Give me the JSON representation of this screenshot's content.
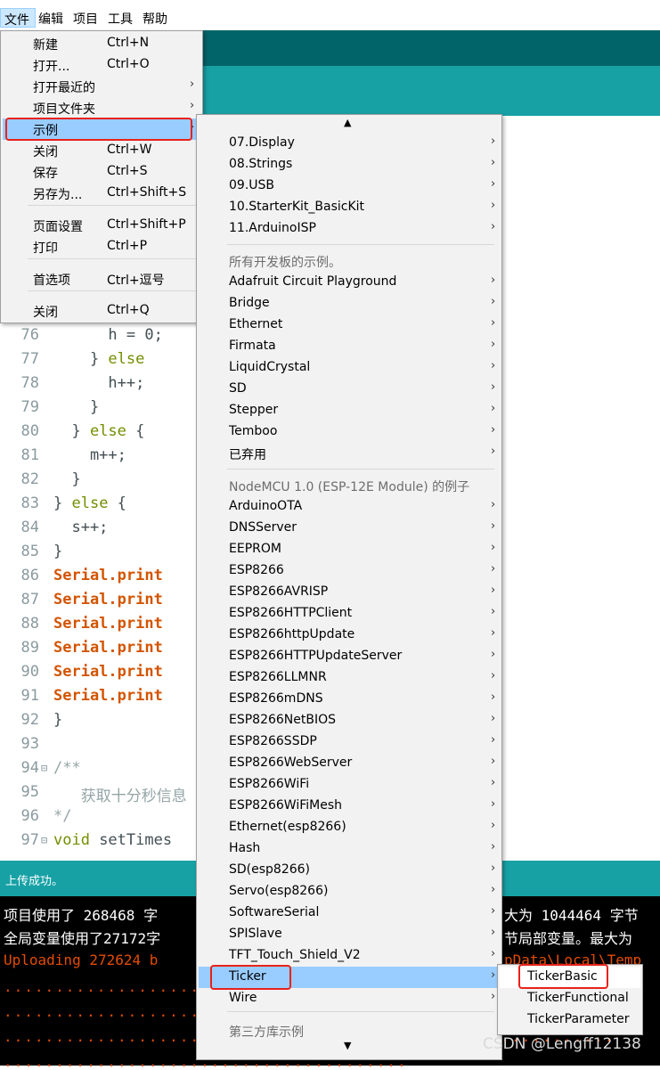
{
  "menubar": {
    "items": [
      "文件",
      "编辑",
      "项目",
      "工具",
      "帮助"
    ]
  },
  "file_menu": {
    "items": [
      {
        "label": "新建",
        "shortcut": "Ctrl+N"
      },
      {
        "label": "打开...",
        "shortcut": "Ctrl+O"
      },
      {
        "label": "打开最近的",
        "shortcut": "",
        "submenu": true
      },
      {
        "label": "项目文件夹",
        "shortcut": "",
        "submenu": true
      },
      {
        "label": "示例",
        "shortcut": "",
        "submenu": true,
        "selected": true
      },
      {
        "label": "关闭",
        "shortcut": "Ctrl+W"
      },
      {
        "label": "保存",
        "shortcut": "Ctrl+S"
      },
      {
        "label": "另存为...",
        "shortcut": "Ctrl+Shift+S"
      },
      {
        "label": "页面设置",
        "shortcut": "Ctrl+Shift+P"
      },
      {
        "label": "打印",
        "shortcut": "Ctrl+P"
      },
      {
        "label": "首选项",
        "shortcut": "Ctrl+逗号"
      },
      {
        "label": "关闭",
        "shortcut": "Ctrl+Q"
      }
    ]
  },
  "examples_menu": {
    "scroll_up": "▲",
    "scroll_down": "▼",
    "builtin": [
      "07.Display",
      "08.Strings",
      "09.USB",
      "10.StarterKit_BasicKit",
      "11.ArduinoISP"
    ],
    "all_boards_header": "所有开发板的示例。",
    "all_boards": [
      "Adafruit Circuit Playground",
      "Bridge",
      "Ethernet",
      "Firmata",
      "LiquidCrystal",
      "SD",
      "Stepper",
      "Temboo",
      "已弃用"
    ],
    "board_header": "NodeMCU 1.0 (ESP-12E Module) 的例子",
    "board": [
      "ArduinoOTA",
      "DNSServer",
      "EEPROM",
      "ESP8266",
      "ESP8266AVRISP",
      "ESP8266HTTPClient",
      "ESP8266httpUpdate",
      "ESP8266HTTPUpdateServer",
      "ESP8266LLMNR",
      "ESP8266mDNS",
      "ESP8266NetBIOS",
      "ESP8266SSDP",
      "ESP8266WebServer",
      "ESP8266WiFi",
      "ESP8266WiFiMesh",
      "Ethernet(esp8266)",
      "Hash",
      "SD(esp8266)",
      "Servo(esp8266)",
      "SoftwareSerial",
      "SPISlave",
      "TFT_Touch_Shield_V2",
      "Ticker",
      "Wire"
    ],
    "selected": "Ticker",
    "third_party_header": "第三方库示例"
  },
  "ticker_menu": {
    "items": [
      "TickerBasic",
      "TickerFunctional",
      "TickerParameter"
    ],
    "highlighted": "TickerBasic"
  },
  "editor": {
    "lines": [
      {
        "n": "76",
        "code": "      h = 0;"
      },
      {
        "n": "77",
        "code": "    } else"
      },
      {
        "n": "78",
        "code": "      h++;"
      },
      {
        "n": "79",
        "code": "    }"
      },
      {
        "n": "80",
        "code": "  } else {"
      },
      {
        "n": "81",
        "code": "    m++;"
      },
      {
        "n": "82",
        "code": "  }"
      },
      {
        "n": "83",
        "code": "} else {"
      },
      {
        "n": "84",
        "code": "  s++;"
      },
      {
        "n": "85",
        "code": "}"
      },
      {
        "n": "86",
        "code": "Serial.print"
      },
      {
        "n": "87",
        "code": "Serial.print"
      },
      {
        "n": "88",
        "code": "Serial.print"
      },
      {
        "n": "89",
        "code": "Serial.print"
      },
      {
        "n": "90",
        "code": "Serial.print"
      },
      {
        "n": "91",
        "code": "Serial.print"
      },
      {
        "n": "92",
        "code": "}"
      },
      {
        "n": "93",
        "code": ""
      },
      {
        "n": "94",
        "code": "/**"
      },
      {
        "n": "95",
        "code": "   获取十分秒信息"
      },
      {
        "n": "96",
        "code": "*/"
      },
      {
        "n": "97",
        "code": "void setTimes"
      }
    ],
    "fold_marker": "⊟"
  },
  "status": {
    "message": "上传成功。"
  },
  "console": {
    "line1": "项目使用了 268468 字",
    "line1_tail": "大为 1044464 字节",
    "line2": "全局变量使用了27172字",
    "line2_tail": "节局部变量。最大为",
    "line3": "Uploading 272624 b",
    "line3_tail": "pData\\Local\\Temp"
  },
  "watermark": "CSDN @Lengff12138",
  "colors": {
    "teal_dark": "#006468",
    "teal": "#17a1a5",
    "highlight": "#99ccff",
    "red_box": "#e8221b"
  }
}
